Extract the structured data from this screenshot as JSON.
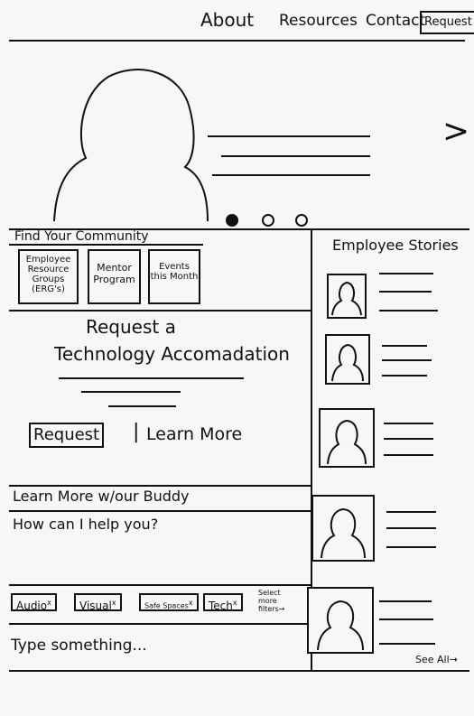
{
  "nav": {
    "about": "About",
    "resources": "Resources",
    "contact": "Contact",
    "request": "Request"
  },
  "hero": {
    "next_arrow": ">"
  },
  "community": {
    "heading": "Find Your Community",
    "tiles": [
      "Employee Resource Groups (ERG's)",
      "Mentor Program",
      "Events this Month"
    ]
  },
  "accommodation": {
    "title_line1": "Request a",
    "title_line2": "Technology Accomadation",
    "request_button": "Request",
    "separator": "|",
    "learn_more": "Learn More"
  },
  "buddy": {
    "heading": "Learn More w/our Buddy",
    "prompt": "How can I help you?",
    "filters": [
      "Audio",
      "Visual",
      "Safe Spaces",
      "Tech"
    ],
    "filter_remove": "x",
    "more_filters": "Select more filters→",
    "input_placeholder": "Type something..."
  },
  "stories": {
    "heading": "Employee Stories",
    "see_all": "See All→"
  }
}
